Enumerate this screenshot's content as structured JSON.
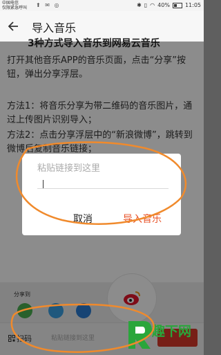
{
  "status_bar": {
    "carrier_line1": "中国电信",
    "carrier_line2": "仅限紧急呼叫",
    "battery": "40%",
    "time": "11:05"
  },
  "app_bar": {
    "title": "导入音乐"
  },
  "content": {
    "heading": "3种方式导入音乐到网易云音乐",
    "para1": "打开其他音乐APP的音乐页面，点击“分享”按钮，弹出分享浮层。",
    "para2": "方法1：将音乐分享为带二维码的音乐图片，通过上传图片识别导入；",
    "para3": "方法2：点击分享浮层中的“新浪微博”，跳转到微博后复制音乐链接；"
  },
  "dialog": {
    "placeholder": "粘贴链接到这里",
    "cancel_label": "取消",
    "import_label": "导入音乐"
  },
  "share_sheet": {
    "label": "分享到"
  },
  "bottom_bar": {
    "scan_label": "扫码",
    "input_placeholder": "粘贴链接到这里"
  },
  "watermark": {
    "text": "趣下网"
  },
  "colors": {
    "accent": "#e8552b",
    "annotation": "#f08a2c"
  }
}
